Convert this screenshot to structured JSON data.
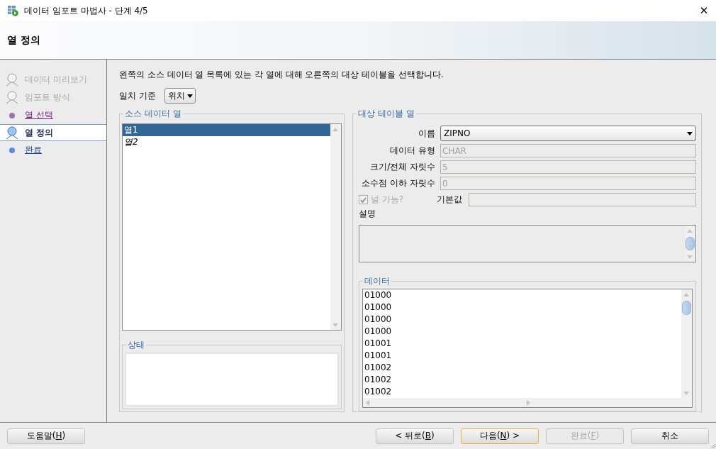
{
  "window": {
    "title": "데이터 임포트 마법사 - 단계 4/5",
    "close": "✕"
  },
  "header": {
    "title": "열 정의"
  },
  "steps": [
    {
      "label": "데이터 미리보기",
      "kind": "disabled",
      "selected": false
    },
    {
      "label": "임포트 방식",
      "kind": "disabled",
      "selected": false
    },
    {
      "label": "열 선택",
      "kind": "visited",
      "selected": false
    },
    {
      "label": "열 정의",
      "kind": "current",
      "selected": true
    },
    {
      "label": "완료",
      "kind": "link",
      "selected": false
    }
  ],
  "instruction": "왼쪽의 소스 데이터 열 목록에 있는 각 열에 대해 오른쪽의 대상 테이블을 선택합니다.",
  "match": {
    "label": "일치 기준",
    "value": "위치"
  },
  "source": {
    "title": "소스 데이터 열",
    "items": [
      {
        "label": "열1",
        "kind": "plain",
        "selected": true
      },
      {
        "label": "열2",
        "kind": "italic",
        "selected": false
      }
    ],
    "status_title": "상태"
  },
  "target": {
    "title": "대상 테이블 열",
    "name": {
      "label": "이름",
      "value": "ZIPNO"
    },
    "fields": [
      {
        "label": "데이터 유형",
        "value": "CHAR"
      },
      {
        "label": "크기/전체 자릿수",
        "value": "5"
      },
      {
        "label": "소수점 이하 자릿수",
        "value": "0"
      }
    ],
    "nullable": {
      "label": "널 가능?",
      "checked": true,
      "disabled": true
    },
    "default": {
      "label": "기본값"
    },
    "description": {
      "label": "설명"
    },
    "data": {
      "title": "데이터",
      "rows": [
        "01000",
        "01000",
        "01000",
        "01000",
        "01001",
        "01001",
        "01002",
        "01002",
        "01002"
      ]
    }
  },
  "buttons": [
    {
      "kind": "help",
      "before": "도움말(",
      "mnemonic": "H",
      "after": ")",
      "focused": false,
      "disabled": false
    },
    {
      "kind": "back",
      "before": "< 뒤로(",
      "mnemonic": "B",
      "after": ")",
      "focused": false,
      "disabled": false
    },
    {
      "kind": "next",
      "before": "다음(",
      "mnemonic": "N",
      "after": ") >",
      "focused": true,
      "disabled": false
    },
    {
      "kind": "finish",
      "before": "완료(",
      "mnemonic": "F",
      "after": ")",
      "focused": false,
      "disabled": true
    },
    {
      "kind": "cancel",
      "before": "취소",
      "focused": false,
      "disabled": false
    }
  ]
}
